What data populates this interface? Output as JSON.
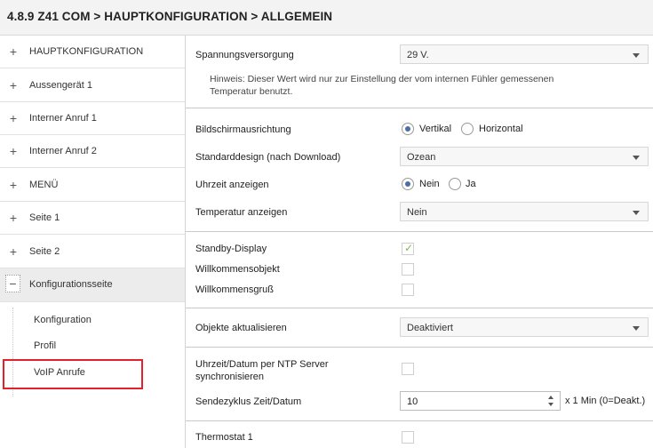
{
  "title": "4.8.9 Z41 COM > HAUPTKONFIGURATION > ALLGEMEIN",
  "sidebar": {
    "items": [
      {
        "symbol": "+",
        "label": "HAUPTKONFIGURATION"
      },
      {
        "symbol": "+",
        "label": "Aussengerät 1"
      },
      {
        "symbol": "+",
        "label": "Interner Anruf 1"
      },
      {
        "symbol": "+",
        "label": "Interner Anruf 2"
      },
      {
        "symbol": "+",
        "label": "MENÜ"
      },
      {
        "symbol": "+",
        "label": "Seite 1"
      },
      {
        "symbol": "+",
        "label": "Seite 2"
      },
      {
        "symbol": "−",
        "label": "Konfigurationsseite"
      }
    ],
    "subitems": [
      "Konfiguration",
      "Profil",
      "VoIP Anrufe"
    ]
  },
  "main": {
    "spannung": {
      "label": "Spannungsversorgung",
      "value": "29 V."
    },
    "hint": "Hinweis: Dieser Wert wird nur zur Einstellung der vom internen Fühler gemessenen Temperatur benutzt.",
    "ausrichtung": {
      "label": "Bildschirmausrichtung",
      "opt1": "Vertikal",
      "opt2": "Horizontal",
      "selected": "Vertikal"
    },
    "design": {
      "label": "Standarddesign (nach Download)",
      "value": "Ozean"
    },
    "uhrzeit": {
      "label": "Uhrzeit anzeigen",
      "opt1": "Nein",
      "opt2": "Ja",
      "selected": "Nein"
    },
    "temperatur": {
      "label": "Temperatur anzeigen",
      "value": "Nein"
    },
    "standby": {
      "label": "Standby-Display",
      "checked": true
    },
    "willkommensobjekt": {
      "label": "Willkommensobjekt",
      "checked": false
    },
    "willkommensgruss": {
      "label": "Willkommensgruß",
      "checked": false
    },
    "objekte": {
      "label": "Objekte aktualisieren",
      "value": "Deaktiviert"
    },
    "ntp": {
      "label_line1": "Uhrzeit/Datum per NTP Server",
      "label_line2": "synchronisieren",
      "checked": false
    },
    "sendezyklus": {
      "label": "Sendezyklus Zeit/Datum",
      "value": "10",
      "unit": "x 1 Min (0=Deakt.)"
    },
    "thermostat": {
      "label": "Thermostat 1",
      "checked": false
    }
  },
  "colors": {
    "radio_selected": "#4a6fa5",
    "check_mark": "#7cba4a",
    "highlight_box": "#e2212c"
  }
}
